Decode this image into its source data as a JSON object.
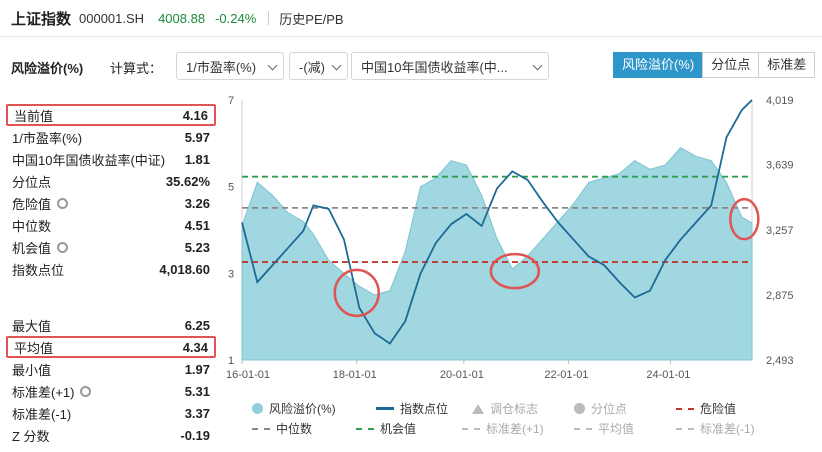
{
  "header": {
    "title": "上证指数",
    "code": "000001.SH",
    "price": "4008.88",
    "change": "-0.24%",
    "history_tab": "历史PE/PB"
  },
  "controls": {
    "section_title": "风险溢价(%)",
    "formula_label": "计算式：",
    "select_1": "1/市盈率(%)",
    "select_2": "-(减)",
    "select_3": "中国10年国债收益率(中...",
    "tabs": [
      {
        "label": "风险溢价(%)",
        "active": true
      },
      {
        "label": "分位点",
        "active": false
      },
      {
        "label": "标准差",
        "active": false
      }
    ]
  },
  "stats": [
    {
      "label": "当前值",
      "value": "4.16",
      "boxed": true,
      "gear": false
    },
    {
      "label": "1/市盈率(%)",
      "value": "5.97",
      "boxed": false,
      "gear": false
    },
    {
      "label": "中国10年国债收益率(中证)",
      "value": "1.81",
      "boxed": false,
      "gear": false
    },
    {
      "label": "分位点",
      "value": "35.62%",
      "boxed": false,
      "gear": false
    },
    {
      "label": "危险值",
      "value": "3.26",
      "boxed": false,
      "gear": true
    },
    {
      "label": "中位数",
      "value": "4.51",
      "boxed": false,
      "gear": false
    },
    {
      "label": "机会值",
      "value": "5.23",
      "boxed": false,
      "gear": true
    },
    {
      "label": "指数点位",
      "value": "4,018.60",
      "boxed": false,
      "gear": false
    },
    {
      "label": "最大值",
      "value": "6.25",
      "boxed": false,
      "gear": false
    },
    {
      "label": "平均值",
      "value": "4.34",
      "boxed": true,
      "gear": false
    },
    {
      "label": "最小值",
      "value": "1.97",
      "boxed": false,
      "gear": false
    },
    {
      "label": "标准差(+1)",
      "value": "5.31",
      "boxed": false,
      "gear": true
    },
    {
      "label": "标准差(-1)",
      "value": "3.37",
      "boxed": false,
      "gear": false
    },
    {
      "label": "Z 分数",
      "value": "-0.19",
      "boxed": false,
      "gear": false
    }
  ],
  "chart_data": {
    "type": "area",
    "x_tick_labels": [
      "16-01-01",
      "18-01-01",
      "20-01-01",
      "22-01-01",
      "24-01-01"
    ],
    "left_axis": {
      "ticks": [
        "1",
        "3",
        "5",
        "7"
      ],
      "range": [
        1,
        7
      ]
    },
    "right_axis": {
      "ticks": [
        "2,493",
        "2,875",
        "3,257",
        "3,639",
        "4,019"
      ],
      "range": [
        2493,
        4019
      ]
    },
    "reference_lines": [
      {
        "name": "危险值",
        "value": 3.26,
        "color": "#c0392b"
      },
      {
        "name": "中位数",
        "value": 4.51,
        "color": "#888888"
      },
      {
        "name": "机会值",
        "value": 5.23,
        "color": "#2e9e4f"
      }
    ],
    "series": [
      {
        "name": "风险溢价(%)",
        "axis": "left",
        "color": "#8fd0da",
        "x": [
          0,
          3,
          6,
          9,
          12,
          14,
          17,
          20,
          23,
          26,
          29,
          32,
          35,
          38,
          41,
          44,
          47,
          50,
          53,
          56,
          59,
          62,
          65,
          68,
          71,
          74,
          77,
          80,
          83,
          86,
          89,
          92,
          95,
          98,
          100
        ],
        "values": [
          4.1,
          5.1,
          4.8,
          4.4,
          4.2,
          3.9,
          3.3,
          3.0,
          2.7,
          2.5,
          2.6,
          3.5,
          5.0,
          5.2,
          5.6,
          5.5,
          4.8,
          3.8,
          3.1,
          3.4,
          3.8,
          4.2,
          4.6,
          5.1,
          5.2,
          5.3,
          5.6,
          5.4,
          5.5,
          5.9,
          5.7,
          5.6,
          5.1,
          4.3,
          4.16
        ]
      },
      {
        "name": "指数点位",
        "axis": "right",
        "color": "#1d6a96",
        "x": [
          0,
          3,
          6,
          9,
          12,
          14,
          17,
          20,
          23,
          26,
          29,
          32,
          35,
          38,
          41,
          44,
          47,
          50,
          53,
          56,
          59,
          62,
          65,
          68,
          71,
          74,
          77,
          80,
          83,
          86,
          89,
          92,
          95,
          98,
          100
        ],
        "values": [
          3300,
          2950,
          3050,
          3150,
          3250,
          3400,
          3380,
          3200,
          2800,
          2650,
          2590,
          2720,
          3000,
          3180,
          3290,
          3350,
          3280,
          3500,
          3600,
          3550,
          3420,
          3300,
          3200,
          3100,
          3050,
          2950,
          2860,
          2900,
          3080,
          3200,
          3300,
          3400,
          3800,
          3960,
          4019
        ]
      }
    ],
    "annotations": [
      "circle near 18-01-01",
      "circle near 21-06",
      "circle at latest value"
    ],
    "legend": [
      {
        "label": "风险溢价(%)",
        "kind": "area-dot",
        "color": "#8fd0da",
        "dim": false
      },
      {
        "label": "指数点位",
        "kind": "line",
        "color": "#1d6a96",
        "dim": false
      },
      {
        "label": "调仓标志",
        "kind": "triangle",
        "color": "#bbbbbb",
        "dim": true
      },
      {
        "label": "分位点",
        "kind": "dot",
        "color": "#bbbbbb",
        "dim": true
      },
      {
        "label": "危险值",
        "kind": "dash",
        "color": "#c0392b",
        "dim": false
      },
      {
        "label": "中位数",
        "kind": "dash",
        "color": "#888888",
        "dim": false
      },
      {
        "label": "机会值",
        "kind": "dash",
        "color": "#2e9e4f",
        "dim": false
      },
      {
        "label": "标准差(+1)",
        "kind": "dash",
        "color": "#bbbbbb",
        "dim": true
      },
      {
        "label": "平均值",
        "kind": "dash",
        "color": "#bbbbbb",
        "dim": true
      },
      {
        "label": "标准差(-1)",
        "kind": "dash",
        "color": "#bbbbbb",
        "dim": true
      }
    ]
  }
}
